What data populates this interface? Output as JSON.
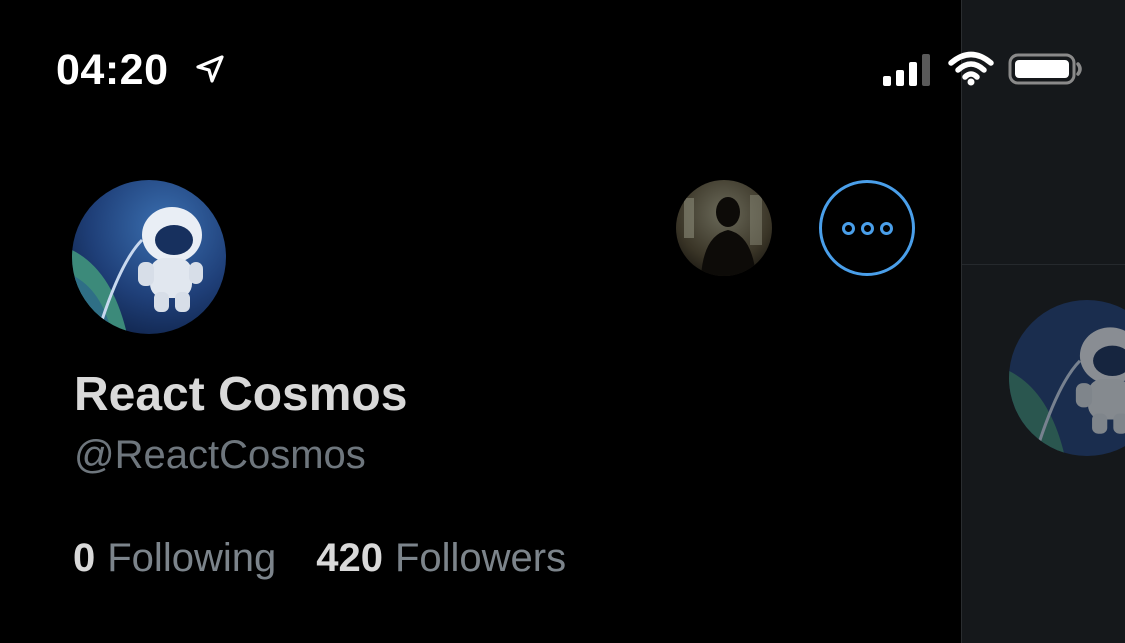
{
  "status_bar": {
    "time": "04:20",
    "location_icon": "location-arrow-icon",
    "signal_icon": "cellular-signal-icon",
    "wifi_icon": "wifi-icon",
    "battery_icon": "battery-icon"
  },
  "profile": {
    "display_name": "React Cosmos",
    "handle": "@ReactCosmos",
    "avatar_icon": "astronaut-avatar",
    "following_count": "0",
    "following_label": "Following",
    "followers_count": "420",
    "followers_label": "Followers"
  },
  "header_actions": {
    "account_switcher_icon": "account-avatar",
    "more_icon": "more-options-icon"
  },
  "colors": {
    "background": "#000000",
    "accent": "#4a9fea",
    "primary_text": "#d9d9d9",
    "secondary_text": "#6e767d",
    "side_pane": "#15181b"
  }
}
